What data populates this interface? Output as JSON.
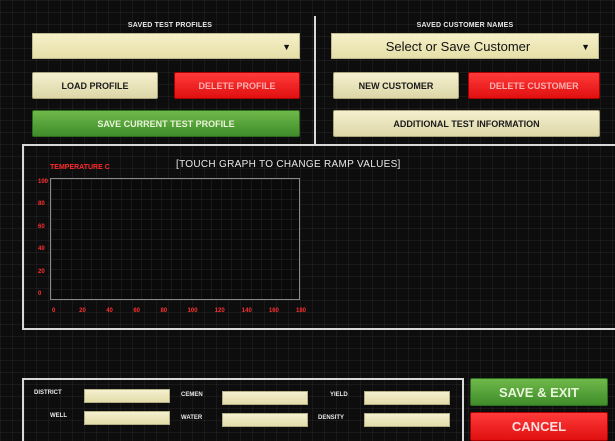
{
  "profiles": {
    "title": "SAVED TEST PROFILES",
    "select_value": "",
    "load_label": "LOAD PROFILE",
    "delete_label": "DELETE PROFILE",
    "save_label": "SAVE CURRENT TEST PROFILE"
  },
  "customers": {
    "title": "SAVED CUSTOMER NAMES",
    "select_value": "Select or Save Customer",
    "new_label": "NEW CUSTOMER",
    "delete_label": "DELETE CUSTOMER",
    "additional_label": "ADDITIONAL TEST INFORMATION"
  },
  "graph": {
    "instruction": "[TOUCH GRAPH TO CHANGE RAMP VALUES]",
    "y_label": "TEMPERATURE C",
    "y_ticks": [
      "100",
      "80",
      "60",
      "40",
      "20",
      "0"
    ],
    "x_ticks": [
      "0",
      "20",
      "40",
      "60",
      "80",
      "100",
      "120",
      "140",
      "160",
      "180"
    ]
  },
  "info": {
    "district_label": "DISTRICT",
    "district_value": "",
    "well_label": "WELL",
    "well_value": "",
    "cement_label": "CEMEN",
    "cement_value": "",
    "water_label": "WATER",
    "water_value": "",
    "yield_label": "YIELD",
    "yield_value": "",
    "density_label": "DENSITY",
    "density_value": ""
  },
  "actions": {
    "save_exit_label": "SAVE & EXIT",
    "cancel_label": "CANCEL"
  },
  "colors": {
    "accent_red": "#e01010",
    "accent_green": "#3f8d2b",
    "field_beige": "#f5f0cf"
  }
}
